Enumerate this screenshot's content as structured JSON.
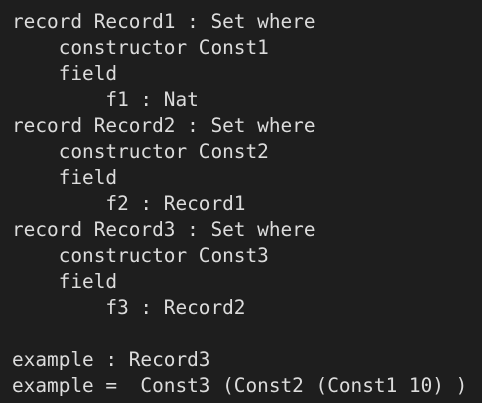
{
  "editor": {
    "lines": [
      "record Record1 : Set where",
      "    constructor Const1",
      "    field",
      "        f1 : Nat",
      "record Record2 : Set where",
      "    constructor Const2",
      "    field",
      "        f2 : Record1",
      "record Record3 : Set where",
      "    constructor Const3",
      "    field",
      "        f3 : Record2",
      "",
      "example : Record3",
      "example =  Const3 (Const2 (Const1 10) )"
    ]
  },
  "colors": {
    "background": "#1e1e1e",
    "text": "#dcdcdc"
  }
}
